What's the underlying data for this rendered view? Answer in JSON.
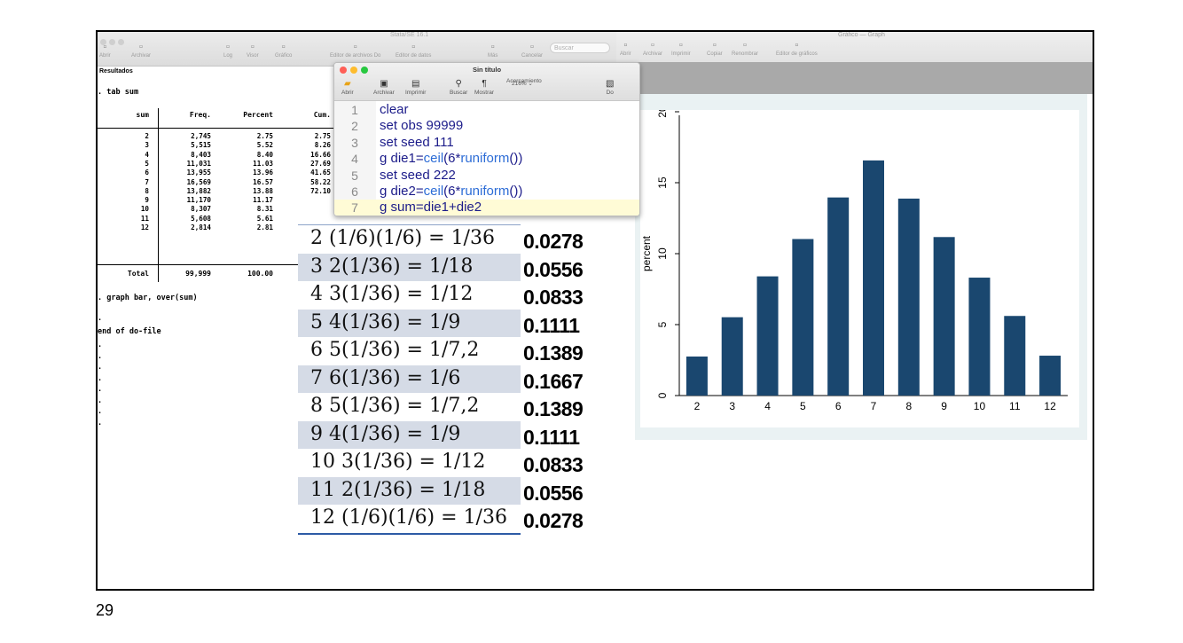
{
  "slide_number": "29",
  "results_window": {
    "app_title": "Stata/SE 16.1",
    "toolbar": [
      {
        "label": "Abrir",
        "icon": "folder-icon"
      },
      {
        "label": "Archivar",
        "icon": "save-icon"
      },
      {
        "label": "Log",
        "icon": "log-icon"
      },
      {
        "label": "Visor",
        "icon": "eye-icon"
      },
      {
        "label": "Gráfico",
        "icon": "graph-icon"
      },
      {
        "label": "Editor de archivos Do",
        "icon": "do-editor-icon"
      },
      {
        "label": "Editor de datos",
        "icon": "data-editor-icon"
      },
      {
        "label": "Más",
        "icon": "more-icon"
      },
      {
        "label": "Cancelar",
        "icon": "cancel-icon"
      }
    ],
    "search_placeholder": "Buscar",
    "pane_title": "Resultados",
    "command_tab": ". tab sum",
    "table_headers": {
      "sum": "sum",
      "freq": "Freq.",
      "percent": "Percent",
      "cum": "Cum."
    },
    "table_rows": [
      {
        "sum": "2",
        "freq": "2,745",
        "percent": "2.75",
        "cum": "2.75"
      },
      {
        "sum": "3",
        "freq": "5,515",
        "percent": "5.52",
        "cum": "8.26"
      },
      {
        "sum": "4",
        "freq": "8,403",
        "percent": "8.40",
        "cum": "16.66"
      },
      {
        "sum": "5",
        "freq": "11,031",
        "percent": "11.03",
        "cum": "27.69"
      },
      {
        "sum": "6",
        "freq": "13,955",
        "percent": "13.96",
        "cum": "41.65"
      },
      {
        "sum": "7",
        "freq": "16,569",
        "percent": "16.57",
        "cum": "58.22"
      },
      {
        "sum": "8",
        "freq": "13,882",
        "percent": "13.88",
        "cum": "72.10"
      },
      {
        "sum": "9",
        "freq": "11,170",
        "percent": "11.17",
        "cum": ""
      },
      {
        "sum": "10",
        "freq": "8,307",
        "percent": "8.31",
        "cum": ""
      },
      {
        "sum": "11",
        "freq": "5,608",
        "percent": "5.61",
        "cum": ""
      },
      {
        "sum": "12",
        "freq": "2,814",
        "percent": "2.81",
        "cum": ""
      }
    ],
    "total_row": {
      "label": "Total",
      "freq": "99,999",
      "percent": "100.00"
    },
    "command_graph": ". graph bar, over(sum)",
    "prompt_dot": ".",
    "end_text": "end of do-file"
  },
  "dofile_window": {
    "title": "Sin título",
    "toolbar": [
      {
        "label": "Abrir",
        "icon": "folder-icon"
      },
      {
        "label": "Archivar",
        "icon": "save-icon"
      },
      {
        "label": "Imprimir",
        "icon": "print-icon"
      },
      {
        "label": "Buscar",
        "icon": "search-icon"
      },
      {
        "label": "Mostrar",
        "icon": "pilcrow-icon"
      },
      {
        "label": "Acercamiento",
        "icon": "zoom-icon"
      },
      {
        "label": "Do",
        "icon": "do-icon"
      }
    ],
    "zoom_value": "216%",
    "code_lines": [
      {
        "num": "1",
        "text": "clear"
      },
      {
        "num": "2",
        "text": "set obs 99999"
      },
      {
        "num": "3",
        "text": "set seed 111"
      },
      {
        "num": "4",
        "text": "g die1=ceil(6*runiform())"
      },
      {
        "num": "5",
        "text": "set seed 222"
      },
      {
        "num": "6",
        "text": "g die2=ceil(6*runiform())"
      },
      {
        "num": "7",
        "text": "g sum=die1+die2"
      }
    ]
  },
  "graph_window": {
    "title": "Gráfico — Graph",
    "toolbar": [
      {
        "label": "Abrir",
        "icon": "folder-icon"
      },
      {
        "label": "Archivar",
        "icon": "save-icon"
      },
      {
        "label": "Imprimir",
        "icon": "print-icon"
      },
      {
        "label": "Copiar",
        "icon": "copy-icon"
      },
      {
        "label": "Renombrar",
        "icon": "rename-icon"
      },
      {
        "label": "Editor de gráficos",
        "icon": "graph-editor-icon"
      }
    ]
  },
  "probability_table": [
    {
      "sum": "2",
      "expr": "(1/6)(1/6) = 1/36",
      "prob": "0.0278",
      "shaded": false
    },
    {
      "sum": "3",
      "expr": "2(1/36) = 1/18",
      "prob": "0.0556",
      "shaded": true
    },
    {
      "sum": "4",
      "expr": "3(1/36) = 1/12",
      "prob": "0.0833",
      "shaded": false
    },
    {
      "sum": "5",
      "expr": "4(1/36) = 1/9",
      "prob": "0.1111",
      "shaded": true
    },
    {
      "sum": "6",
      "expr": "5(1/36) = 1/7,2",
      "prob": "0.1389",
      "shaded": false
    },
    {
      "sum": "7",
      "expr": "6(1/36) = 1/6",
      "prob": "0.1667",
      "shaded": true
    },
    {
      "sum": "8",
      "expr": "5(1/36) = 1/7,2",
      "prob": "0.1389",
      "shaded": false
    },
    {
      "sum": "9",
      "expr": "4(1/36) = 1/9",
      "prob": "0.1111",
      "shaded": true
    },
    {
      "sum": "10",
      "expr": "3(1/36) = 1/12",
      "prob": "0.0833",
      "shaded": false
    },
    {
      "sum": "11",
      "expr": "2(1/36) = 1/18",
      "prob": "0.0556",
      "shaded": true
    },
    {
      "sum": "12",
      "expr": "(1/6)(1/6) = 1/36",
      "prob": "0.0278",
      "shaded": false
    }
  ],
  "chart_data": {
    "type": "bar",
    "categories": [
      "2",
      "3",
      "4",
      "5",
      "6",
      "7",
      "8",
      "9",
      "10",
      "11",
      "12"
    ],
    "values": [
      2.75,
      5.52,
      8.4,
      11.03,
      13.96,
      16.57,
      13.88,
      11.17,
      8.31,
      5.61,
      2.81
    ],
    "ylabel": "percent",
    "yticks": [
      "0",
      "5",
      "10",
      "15",
      "20"
    ],
    "ylim": [
      0,
      20
    ],
    "bar_color": "#1a476f",
    "grid": false
  },
  "colors": {
    "shade_band": "#d5dbe6",
    "graph_background": "#eaf2f3",
    "code_keyword": "#1c1c8a",
    "code_function": "#2c6cd6",
    "close_light": "#ff5f57",
    "minimize_light": "#febc2e",
    "zoom_light": "#28c840"
  }
}
